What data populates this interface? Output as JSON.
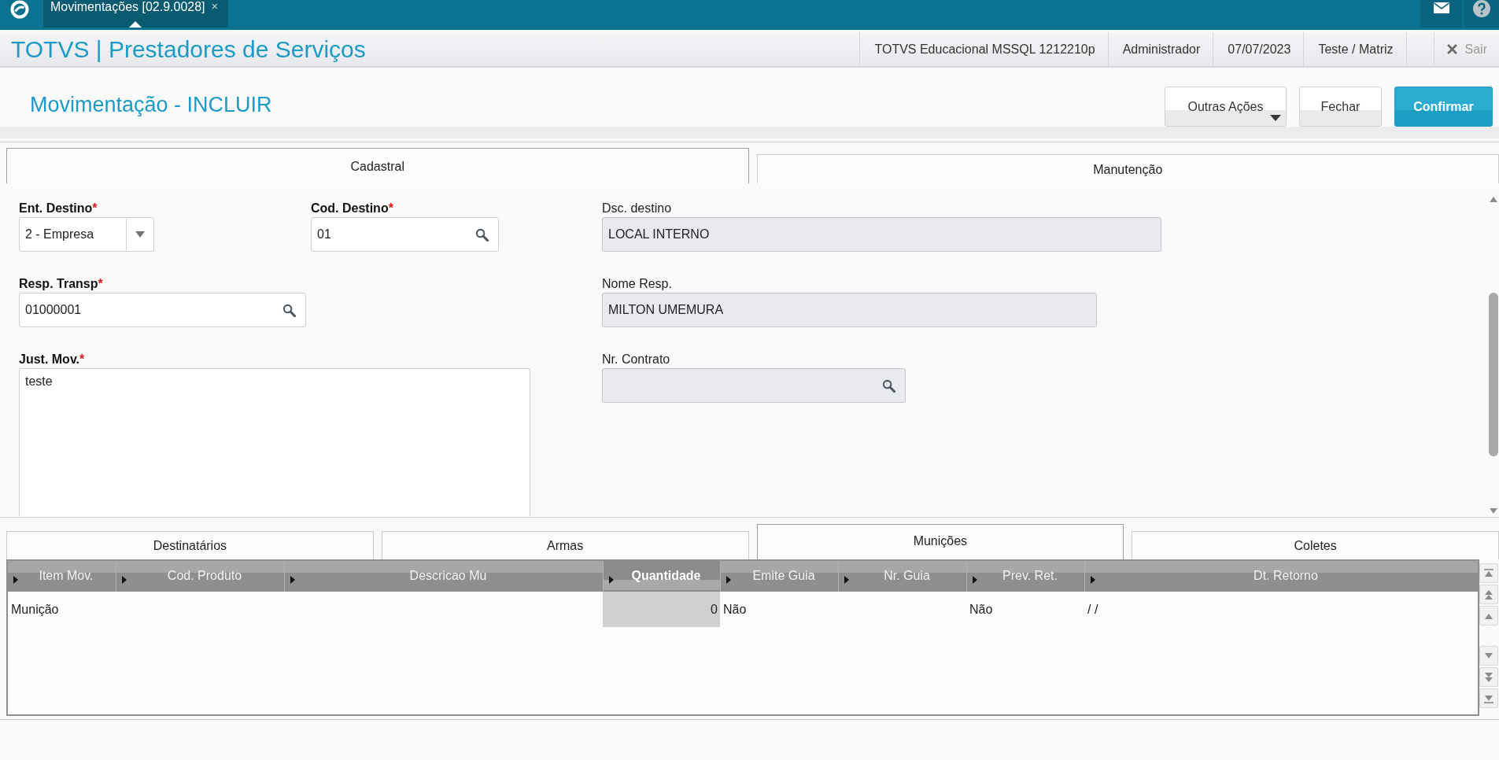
{
  "top_bar": {
    "tab": {
      "title": "Movimentações [02.9.0028]",
      "close": "×"
    }
  },
  "header": {
    "title": "TOTVS | Prestadores de Serviços",
    "info": [
      "TOTVS Educacional MSSQL 1212210p",
      "Administrador",
      "07/07/2023",
      "Teste / Matriz"
    ],
    "logout": "Sair"
  },
  "page": {
    "title": "Movimentação - INCLUIR",
    "buttons": [
      {
        "label": "Outras Ações",
        "kind": "menu"
      },
      {
        "label": "Fechar",
        "kind": "default"
      },
      {
        "label": "Confirmar",
        "kind": "primary"
      }
    ]
  },
  "form_tabs": [
    {
      "label": "Cadastral",
      "selected": true
    },
    {
      "label": "Manutenção",
      "selected": false
    }
  ],
  "form": {
    "rows": [
      {
        "fields": [
          {
            "label": "Ent. Destino",
            "marker": "*",
            "kind": "select",
            "value": "2 - Empresa"
          },
          {
            "label": "Cod. Destino",
            "marker": "*",
            "kind": "lookup",
            "value": "01"
          },
          {
            "label": "Dsc. destino",
            "kind": "readonly",
            "value": "LOCAL INTERNO"
          }
        ]
      },
      {
        "fields": [
          {
            "label": "Resp. Transp",
            "marker": "*",
            "kind": "lookup",
            "value": "01000001"
          },
          {
            "label": "Nome Resp.",
            "kind": "readonly",
            "value": "MILTON UMEMURA"
          }
        ]
      },
      {
        "fields": [
          {
            "label": "Just. Mov.",
            "marker": "*",
            "kind": "textarea",
            "value": "teste"
          },
          {
            "label": "Nr. Contrato",
            "kind": "readonly_lookup"
          }
        ]
      }
    ]
  },
  "grid_tabs": [
    {
      "label": "Destinatários",
      "selected": false
    },
    {
      "label": "Armas",
      "selected": false
    },
    {
      "label": "Munições",
      "selected": true
    },
    {
      "label": "Coletes",
      "selected": false
    }
  ],
  "grid": {
    "columns": [
      {
        "label": "Item Mov.",
        "kind": "text",
        "selected": false
      },
      {
        "label": "Cod. Produto",
        "kind": "text",
        "selected": false
      },
      {
        "label": "Descricao Mu",
        "kind": "text",
        "selected": false
      },
      {
        "label": "Quantidade",
        "kind": "number",
        "selected": true
      },
      {
        "label": "Emite Guia",
        "kind": "text",
        "selected": false
      },
      {
        "label": "Nr. Guia",
        "kind": "text",
        "selected": false
      },
      {
        "label": "Prev. Ret.",
        "kind": "text",
        "selected": false
      },
      {
        "label": "Dt. Retorno",
        "kind": "text",
        "selected": false
      }
    ],
    "rows": [
      {
        "cells": [
          "Munição",
          null,
          null,
          "0",
          "Não",
          null,
          "Não",
          "/ /"
        ]
      }
    ]
  }
}
